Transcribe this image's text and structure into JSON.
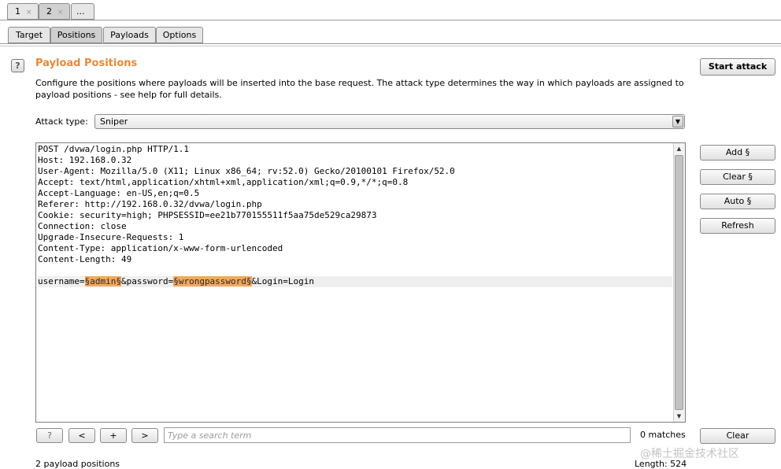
{
  "top_tabs": [
    {
      "label": "1",
      "close": "×"
    },
    {
      "label": "2",
      "close": "×"
    },
    {
      "label": "..."
    }
  ],
  "sub_tabs": [
    "Target",
    "Positions",
    "Payloads",
    "Options"
  ],
  "section": {
    "help": "?",
    "title": "Payload Positions",
    "description": "Configure the positions where payloads will be inserted into the base request. The attack type determines the way in which payloads are assigned to payload positions - see help for full details."
  },
  "attack_type": {
    "label": "Attack type:",
    "value": "Sniper"
  },
  "buttons": {
    "start_attack": "Start attack",
    "add": "Add §",
    "clear": "Clear §",
    "auto": "Auto §",
    "refresh": "Refresh"
  },
  "request_lines": [
    "POST /dvwa/login.php HTTP/1.1",
    "Host: 192.168.0.32",
    "User-Agent: Mozilla/5.0 (X11; Linux x86_64; rv:52.0) Gecko/20100101 Firefox/52.0",
    "Accept: text/html,application/xhtml+xml,application/xml;q=0.9,*/*;q=0.8",
    "Accept-Language: en-US,en;q=0.5",
    "Referer: http://192.168.0.32/dvwa/login.php",
    "Cookie: security=high; PHPSESSID=ee21b770155511f5aa75de529ca29873",
    "Connection: close",
    "Upgrade-Insecure-Requests: 1",
    "Content-Type: application/x-www-form-urlencoded",
    "Content-Length: 49",
    ""
  ],
  "body_line": {
    "seg1": "username=",
    "payload1": "§admin§",
    "seg2": "&password=",
    "payload2": "§wrongpassword§",
    "seg3": "&Login=Login"
  },
  "search": {
    "help": "?",
    "prev": "<",
    "add": "+",
    "next": ">",
    "placeholder": "Type a search term",
    "matches": "0 matches",
    "clear": "Clear"
  },
  "status": {
    "positions": "2 payload positions",
    "length": "Length: 524"
  },
  "watermark": "@稀土掘金技术社区",
  "colors": {
    "title": "#e8893a",
    "payload_highlight": "#f2a85e"
  }
}
